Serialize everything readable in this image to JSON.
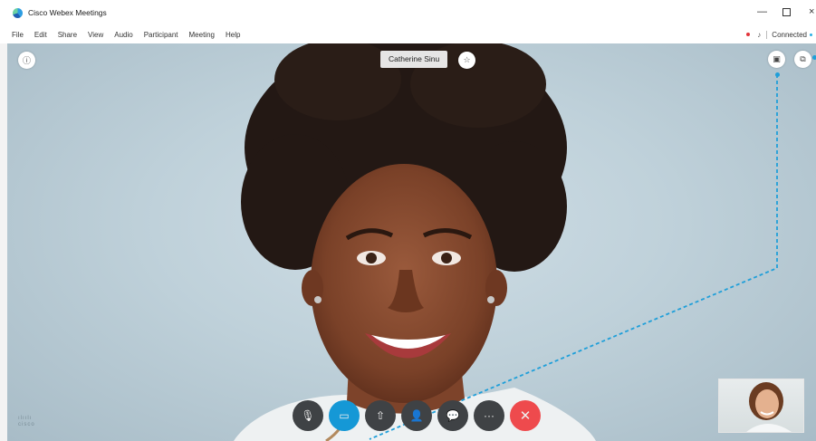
{
  "window": {
    "title": "Cisco Webex Meetings",
    "controls": {
      "minimize": "—",
      "close": "×"
    }
  },
  "menu": {
    "items": [
      {
        "label": "File"
      },
      {
        "label": "Edit"
      },
      {
        "label": "Share"
      },
      {
        "label": "View"
      },
      {
        "label": "Audio"
      },
      {
        "label": "Participant"
      },
      {
        "label": "Meeting"
      },
      {
        "label": "Help"
      }
    ]
  },
  "status": {
    "connection": "Connected"
  },
  "stage": {
    "participant_name": "Catherine Sinu",
    "brand": "cisco"
  },
  "icons": {
    "info": "ⓘ",
    "pin": "☆",
    "layout": "▣",
    "minimize_view": "⧉",
    "mute": "🎙",
    "video": "▭",
    "share": "⇧",
    "participants": "👤",
    "chat": "💬",
    "more": "···",
    "end": "✕",
    "audio": "♪"
  },
  "colors": {
    "accent": "#1598d6",
    "end_call": "#ee4a4d",
    "control_bg": "#3f4245",
    "recording": "#e2343a"
  }
}
